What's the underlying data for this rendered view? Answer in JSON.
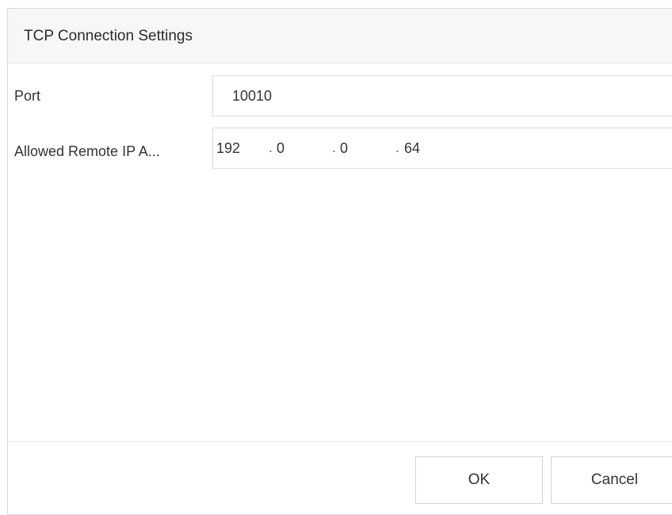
{
  "dialog": {
    "title": "TCP Connection Settings"
  },
  "form": {
    "port": {
      "label": "Port",
      "value": "10010"
    },
    "remote_ip": {
      "label": "Allowed Remote IP A...",
      "octets": [
        "192",
        "0",
        "0",
        "64"
      ],
      "separator": "."
    }
  },
  "buttons": {
    "ok_label": "OK",
    "cancel_label": "Cancel"
  }
}
